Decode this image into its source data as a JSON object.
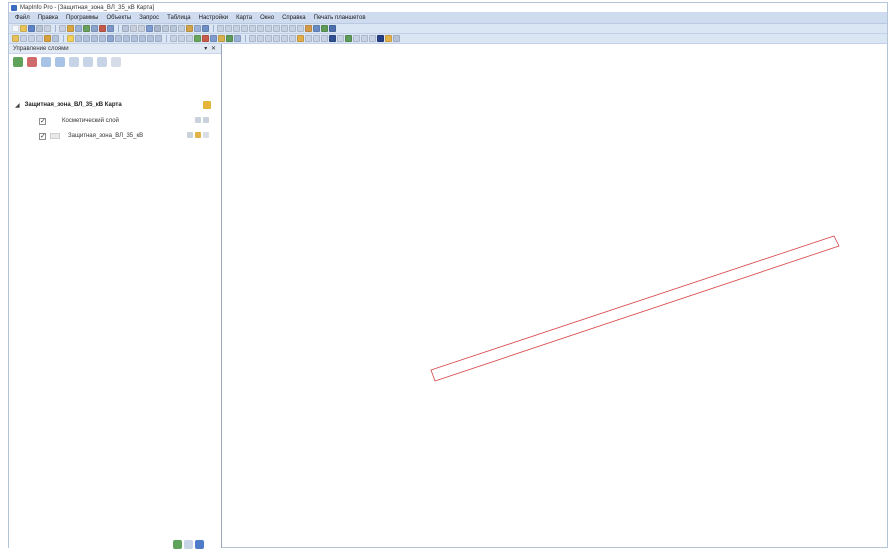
{
  "window": {
    "title": "MapInfo Pro - [Защитная_зона_ВЛ_35_кВ Карта]"
  },
  "menubar": {
    "items": [
      "Файл",
      "Правка",
      "Программы",
      "Объекты",
      "Запрос",
      "Таблица",
      "Настройки",
      "Карта",
      "Окно",
      "Справка",
      "Печать планшетов"
    ]
  },
  "layer_panel": {
    "title": "Управление слоями",
    "controls": "▾ ✕",
    "map": {
      "name": "Защитная_зона_ВЛ_35_кВ Карта",
      "expander": "◢"
    },
    "layers": [
      {
        "name": "Косметический слой",
        "checked": "✓"
      },
      {
        "name": "Защитная_зона_ВЛ_35_кВ",
        "checked": "✓"
      }
    ]
  },
  "map_view": {
    "polygon_color": "#d64545"
  },
  "colors": {
    "menubar": "#cfdcf0",
    "toolbar": "#dbe6f5",
    "accent": "#3b6cc2"
  }
}
